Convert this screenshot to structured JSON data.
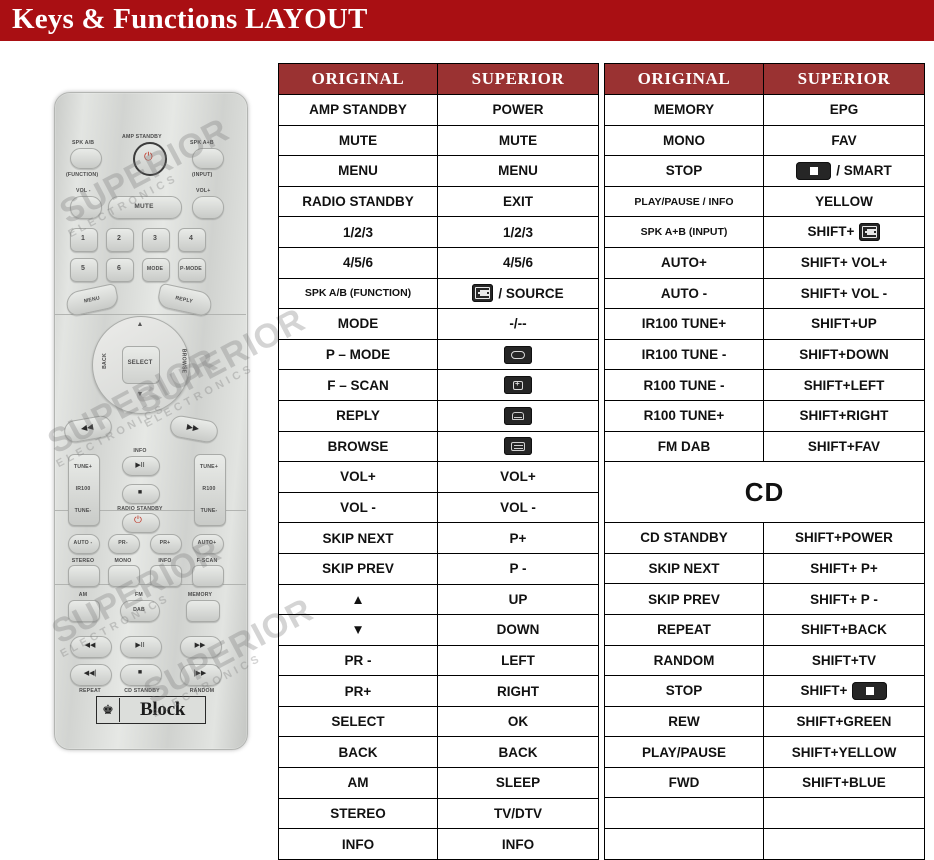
{
  "banner": {
    "title": "Keys & Functions LAYOUT",
    "color": "#a90f13"
  },
  "theme": {
    "header_cell": "#9a3232",
    "border": "#000000",
    "text": "#111111"
  },
  "remote": {
    "brand_name": "Block",
    "watermark_line1": "SUPERIOR",
    "watermark_line2": "ELECTRONICS",
    "labels": {
      "spk_ab": "SPK A/B",
      "function": "(FUNCTION)",
      "amp_standby": "AMP STANDBY",
      "spk_apb": "SPK A+B",
      "input": "(INPUT)",
      "vol_minus": "VOL -",
      "vol_plus": "VOL+",
      "mute": "MUTE",
      "num1": "1",
      "num2": "2",
      "num3": "3",
      "num4": "4",
      "num5": "5",
      "num6": "6",
      "mode": "MODE",
      "pmode": "P-MODE",
      "menu": "MENU",
      "reply": "REPLY",
      "select": "SELECT",
      "back": "BACK",
      "browse": "BROWSE",
      "up": "▲",
      "down": "▼",
      "rew2": "◀◀",
      "ffwd2": "▶▶",
      "tune_plus_l": "TUNE+",
      "ir100": "IR100",
      "tune_minus_l": "TUNE-",
      "tune_plus_r": "TUNE+",
      "r100": "R100",
      "tune_minus_r": "TUNE-",
      "info": "INFO",
      "playpause": "▶II",
      "stop": "■",
      "radio_standby": "RADIO STANDBY",
      "auto_minus": "AUTO -",
      "pr_minus": "PR-",
      "pr_plus": "PR+",
      "auto_plus": "AUTO+",
      "stereo": "STEREO",
      "mono": "MONO",
      "info2": "INFO",
      "fscan": "F-SCAN",
      "am": "AM",
      "fm": "FM",
      "dab": "DAB",
      "memory": "MEMORY",
      "cd_rew": "◀◀",
      "cd_play": "▶II",
      "cd_fwd": "▶▶",
      "cd_prev": "◀◀|",
      "cd_stop": "■",
      "cd_next": "|▶▶",
      "repeat": "REPEAT",
      "cd_standby": "CD STANDBY",
      "random": "RANDOM"
    }
  },
  "tables": [
    {
      "id": "left",
      "headers": [
        "ORIGINAL",
        "SUPERIOR"
      ],
      "rows": [
        {
          "original": "AMP STANDBY",
          "superior": "POWER"
        },
        {
          "original": "MUTE",
          "superior": "MUTE"
        },
        {
          "original": "MENU",
          "superior": "MENU"
        },
        {
          "original": "RADIO STANDBY",
          "superior": "EXIT"
        },
        {
          "original": "1/2/3",
          "superior": "1/2/3"
        },
        {
          "original": "4/5/6",
          "superior": "4/5/6"
        },
        {
          "original": "SPK A/B (FUNCTION)",
          "original_small": true,
          "superior": "/ SOURCE",
          "superior_icon": "source-icon"
        },
        {
          "original": "MODE",
          "superior": "-/--"
        },
        {
          "original": "P – MODE",
          "superior": "",
          "superior_icon": "tv-screen-icon"
        },
        {
          "original": "F – SCAN",
          "superior": "",
          "superior_icon": "fav-scan-icon"
        },
        {
          "original": "REPLY",
          "superior": "",
          "superior_icon": "reply-icon"
        },
        {
          "original": "BROWSE",
          "superior": "",
          "superior_icon": "browse-icon"
        },
        {
          "original": "VOL+",
          "superior": "VOL+"
        },
        {
          "original": "VOL -",
          "superior": "VOL -"
        },
        {
          "original": "SKIP NEXT",
          "superior": "P+"
        },
        {
          "original": "SKIP PREV",
          "superior": "P -"
        },
        {
          "original": "▲",
          "superior": "UP"
        },
        {
          "original": "▼",
          "superior": "DOWN"
        },
        {
          "original": "PR -",
          "superior": "LEFT"
        },
        {
          "original": "PR+",
          "superior": "RIGHT"
        },
        {
          "original": "SELECT",
          "superior": "OK"
        },
        {
          "original": "BACK",
          "superior": "BACK"
        },
        {
          "original": "AM",
          "superior": "SLEEP"
        },
        {
          "original": "STEREO",
          "superior": "TV/DTV"
        },
        {
          "original": "INFO",
          "superior": "INFO"
        }
      ]
    },
    {
      "id": "right",
      "headers": [
        "ORIGINAL",
        "SUPERIOR"
      ],
      "rows": [
        {
          "original": "MEMORY",
          "superior": "EPG"
        },
        {
          "original": "MONO",
          "superior": "FAV"
        },
        {
          "original": "STOP",
          "superior": "/ SMART",
          "superior_icon": "stop-icon"
        },
        {
          "original": "PLAY/PAUSE / INFO",
          "original_small": true,
          "superior": "YELLOW"
        },
        {
          "original": "SPK A+B (INPUT)",
          "original_small": true,
          "superior": "SHIFT+",
          "superior_icon_after": "source-icon"
        },
        {
          "original": "AUTO+",
          "superior": "SHIFT+ VOL+"
        },
        {
          "original": "AUTO -",
          "superior": "SHIFT+ VOL -"
        },
        {
          "original": "IR100 TUNE+",
          "superior": "SHIFT+UP"
        },
        {
          "original": "IR100 TUNE -",
          "superior": "SHIFT+DOWN"
        },
        {
          "original": "R100 TUNE -",
          "superior": "SHIFT+LEFT"
        },
        {
          "original": "R100 TUNE+",
          "superior": "SHIFT+RIGHT"
        },
        {
          "original": "FM DAB",
          "superior": "SHIFT+FAV"
        },
        {
          "section": "CD"
        },
        {
          "original": "CD STANDBY",
          "superior": "SHIFT+POWER"
        },
        {
          "original": "SKIP NEXT",
          "superior": "SHIFT+ P+"
        },
        {
          "original": "SKIP PREV",
          "superior": "SHIFT+ P -"
        },
        {
          "original": "REPEAT",
          "superior": "SHIFT+BACK"
        },
        {
          "original": "RANDOM",
          "superior": "SHIFT+TV"
        },
        {
          "original": "STOP",
          "superior": "SHIFT+",
          "superior_icon_after": "stop-icon"
        },
        {
          "original": "REW",
          "superior": "SHIFT+GREEN"
        },
        {
          "original": "PLAY/PAUSE",
          "superior": "SHIFT+YELLOW"
        },
        {
          "original": "FWD",
          "superior": "SHIFT+BLUE"
        },
        {
          "original": "",
          "superior": ""
        },
        {
          "original": "",
          "superior": ""
        }
      ]
    }
  ]
}
